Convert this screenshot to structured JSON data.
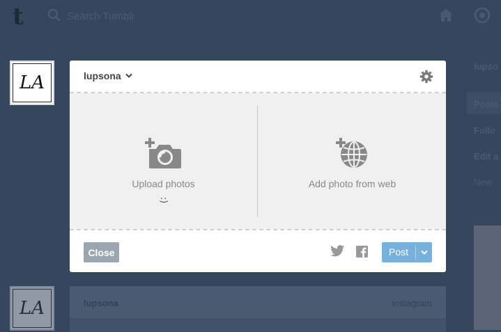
{
  "background": {
    "search": {
      "placeholder": "Search Tumblr"
    },
    "avatar_monogram": "LA",
    "post_card": {
      "user": "lupsona",
      "source": "instagram"
    },
    "sidebar": {
      "items": [
        "lupso",
        "Poste",
        "Follo",
        "Edit a",
        "New"
      ]
    }
  },
  "composer": {
    "blog_name": "lupsona",
    "upload_label": "Upload photos",
    "upload_hint": ":)",
    "web_label": "Add photo from web",
    "close_label": "Close",
    "post_label": "Post"
  },
  "colors": {
    "page_background": "#36465d",
    "post_button": "#76b1de",
    "close_button": "#9da6af",
    "drop_area": "#f0f0f0"
  },
  "icons": [
    "tumblr-logo",
    "search-icon",
    "home-icon",
    "compass-icon",
    "gear-icon",
    "camera-plus-icon",
    "globe-plus-icon",
    "twitter-icon",
    "facebook-icon",
    "chevron-down-icon"
  ]
}
